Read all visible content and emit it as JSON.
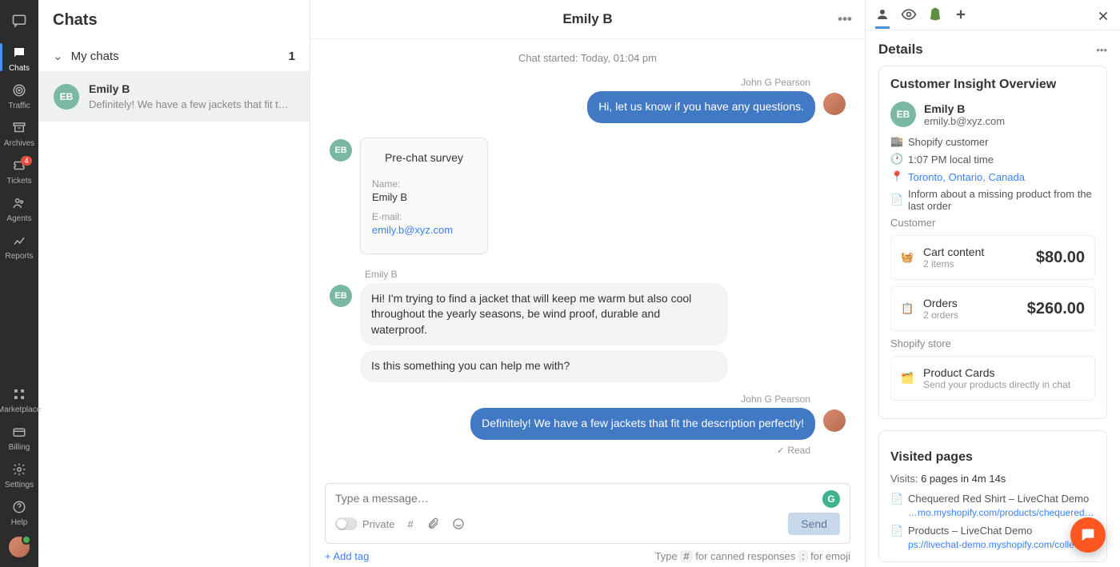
{
  "rail": {
    "items": [
      {
        "label": "Chats",
        "icon": "chat"
      },
      {
        "label": "Traffic",
        "icon": "radar"
      },
      {
        "label": "Archives",
        "icon": "archive"
      },
      {
        "label": "Tickets",
        "icon": "ticket",
        "badge": "4"
      },
      {
        "label": "Agents",
        "icon": "agents"
      },
      {
        "label": "Reports",
        "icon": "reports"
      }
    ],
    "bottom_items": [
      {
        "label": "Marketplace"
      },
      {
        "label": "Billing"
      },
      {
        "label": "Settings"
      },
      {
        "label": "Help"
      }
    ]
  },
  "list": {
    "title": "Chats",
    "my_chats_label": "My chats",
    "my_chats_count": "1",
    "rows": [
      {
        "initials": "EB",
        "name": "Emily B",
        "preview": "Definitely! We have a few jackets that fit the desc…"
      }
    ]
  },
  "chat": {
    "title": "Emily B",
    "date_sep": "Chat started: Today, 01:04 pm",
    "sender_agent": "John G Pearson",
    "sender_cust": "Emily B",
    "msg1": "Hi, let us know if you have any questions.",
    "survey_title": "Pre-chat survey",
    "survey_name_label": "Name:",
    "survey_name_val": "Emily B",
    "survey_email_label": "E-mail:",
    "survey_email_val": "emily.b@xyz.com",
    "msg_cust1": "Hi! I'm trying to find a jacket that will keep me warm but also cool throughout the yearly seasons, be wind proof, durable and waterproof.",
    "msg_cust2": "Is this something you can help me with?",
    "msg_agent2": "Definitely! We have a few jackets that fit the description perfectly!",
    "read": "Read",
    "composer_placeholder": "Type a message…",
    "private_label": "Private",
    "send_label": "Send",
    "add_tag": "+ Add tag",
    "hint_type": "Type",
    "hint_hash": "#",
    "hint_canned": "for canned responses",
    "hint_colon": ":",
    "hint_emoji": "for emoji"
  },
  "details": {
    "title": "Details",
    "overview_title": "Customer Insight Overview",
    "initials": "EB",
    "name": "Emily B",
    "email": "emily.b@xyz.com",
    "shop_customer": "Shopify customer",
    "local_time": "1:07 PM local time",
    "location": "Toronto, Ontario, Canada",
    "note": "Inform about a missing product from the last order",
    "customer_label": "Customer",
    "cart_title": "Cart content",
    "cart_sub": "2 items",
    "cart_amt": "$80.00",
    "orders_title": "Orders",
    "orders_sub": "2 orders",
    "orders_amt": "$260.00",
    "store_label": "Shopify store",
    "prodcards_title": "Product Cards",
    "prodcards_sub": "Send your products directly in chat",
    "visited_title": "Visited pages",
    "visits_label": "Visits:",
    "visits_val": "6 pages in 4m 14s",
    "page1_title": "Chequered Red Shirt – LiveChat Demo",
    "page1_url": "…mo.myshopify.com/products/chequered-re…",
    "page2_title": "Products – LiveChat Demo",
    "page2_url": "ps://livechat-demo.myshopify.com/collections/all"
  }
}
